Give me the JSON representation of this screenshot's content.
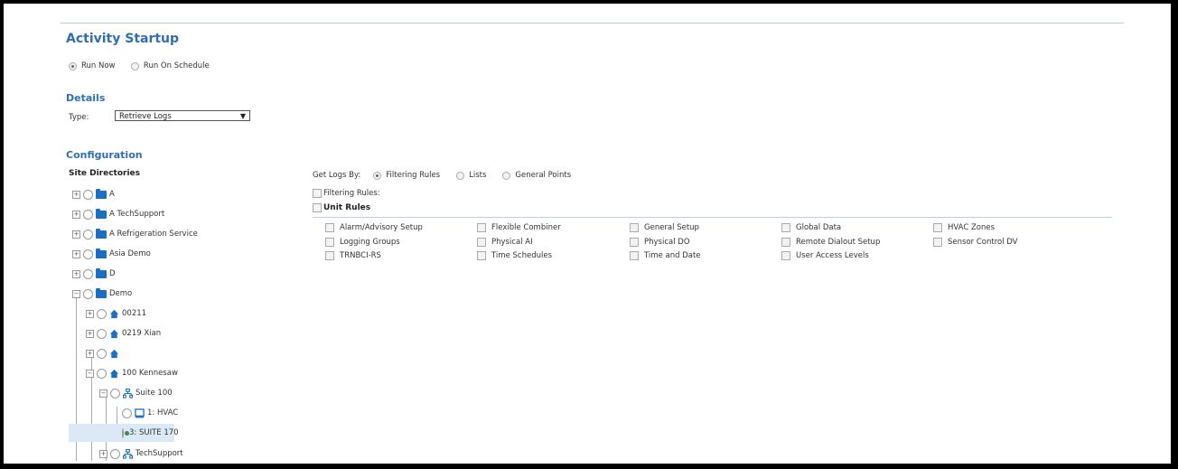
{
  "header": {
    "title": "Activity Startup"
  },
  "startup": {
    "run_now": "Run Now",
    "run_on_schedule": "Run On Schedule"
  },
  "details": {
    "heading": "Details",
    "type_label": "Type:",
    "type_value": "Retrieve Logs"
  },
  "configuration": {
    "heading": "Configuration",
    "site_dirs_label": "Site Directories"
  },
  "get_logs": {
    "label": "Get Logs By:",
    "options": [
      "Filtering Rules",
      "Lists",
      "General Points"
    ],
    "selected": "Filtering Rules"
  },
  "filtering_rules_label": "Filtering Rules:",
  "unit_rules": {
    "heading": "Unit Rules",
    "items": [
      "Alarm/Advisory Setup",
      "Flexible Combiner",
      "General Setup",
      "Global Data",
      "HVAC Zones",
      "Logging Groups",
      "Physical AI",
      "Physical DO",
      "Remote Dialout Setup",
      "Sensor Control DV",
      "TRNBCI-RS",
      "Time Schedules",
      "Time and Date",
      "User Access Levels"
    ]
  },
  "tree": [
    {
      "label": "A",
      "icon": "folder-icon"
    },
    {
      "label": "A TechSupport",
      "icon": "folder-icon"
    },
    {
      "label": "A Refrigeration Service",
      "icon": "folder-icon"
    },
    {
      "label": "Asia Demo",
      "icon": "folder-icon"
    },
    {
      "label": "D",
      "icon": "folder-icon"
    },
    {
      "label": "Demo",
      "icon": "folder-icon"
    },
    {
      "label": "00211",
      "icon": "home-icon"
    },
    {
      "label": "0219 Xian",
      "icon": "home-icon"
    },
    {
      "label": "",
      "icon": "home-icon"
    },
    {
      "label": "100 Kennesaw",
      "icon": "home-icon"
    },
    {
      "label": "Suite 100",
      "icon": "network-icon"
    },
    {
      "label": "1: HVAC",
      "icon": "device-icon"
    },
    {
      "label": "3: SUITE 170",
      "icon": "device-icon",
      "selected": true
    },
    {
      "label": "TechSupport",
      "icon": "network-icon"
    }
  ],
  "colors": {
    "accent": "#2f6eb3",
    "folder": "#1a6fc2",
    "selection": "#dbe8f6"
  }
}
